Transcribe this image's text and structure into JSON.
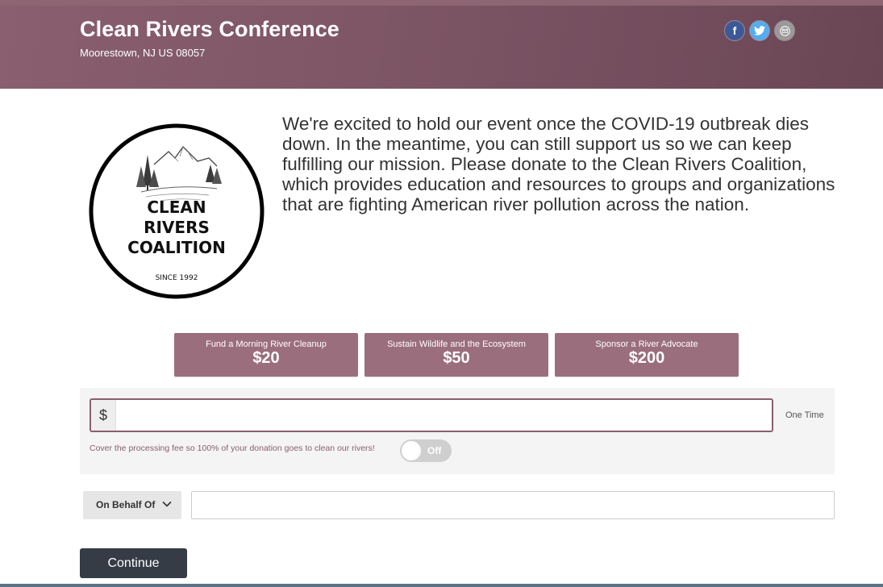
{
  "header": {
    "title": "Clean Rivers Conference",
    "location": "Moorestown, NJ US 08057",
    "share": [
      {
        "name": "facebook",
        "glyph": "f",
        "color": "#3b5998"
      },
      {
        "name": "twitter",
        "color": "#55acee"
      },
      {
        "name": "email",
        "color": "#9a9a9a"
      }
    ]
  },
  "logo": {
    "line1": "CLEAN",
    "line2": "RIVERS",
    "line3": "COALITION",
    "since": "SINCE 1992"
  },
  "intro": {
    "text": "We're excited to hold our event once the COVID-19 outbreak dies down. In the meantime, you can still support us so we can keep fulfilling our mission. Please donate to the Clean Rivers Coalition, which provides education and resources to groups and organizations that are fighting American river pollution across the nation."
  },
  "amounts": [
    {
      "label": "Fund a Morning River Cleanup",
      "value": "$20"
    },
    {
      "label": "Sustain Wildlife and the Ecosystem",
      "value": "$50"
    },
    {
      "label": "Sponsor a River Advocate",
      "value": "$200"
    }
  ],
  "donation": {
    "currency_symbol": "$",
    "amount_value": "",
    "frequency": "One Time",
    "fee_text": "Cover the processing fee so 100% of your donation goes to clean our rivers!",
    "fee_toggle_label": "Off"
  },
  "behalf": {
    "select_label": "On Behalf Of",
    "input_value": ""
  },
  "actions": {
    "continue_label": "Continue"
  },
  "colors": {
    "brand": "#7a5363",
    "button": "#9b6e7d",
    "continue": "#353c46"
  }
}
